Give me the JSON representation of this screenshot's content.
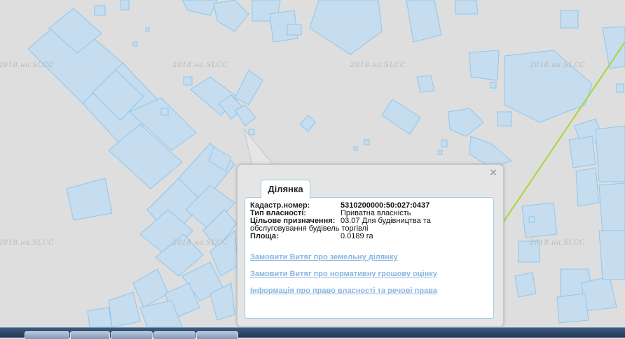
{
  "map": {
    "watermark": "2018.на.SLCC"
  },
  "popup": {
    "close_glyph": "×",
    "tab_label": "Ділянка",
    "fields": {
      "cadastral_label": "Кадастр.номер:",
      "cadastral_value": "5310200000:50:027:0437",
      "ownership_label": "Тип власності:",
      "ownership_value": "Приватна власність",
      "purpose_label": "Цільове призначення:",
      "purpose_value": "03.07 Для будівництва та",
      "purpose_value_cont": "обслуговування будівель торгівлі",
      "area_label": "Площа:",
      "area_value": "0.0189 га"
    },
    "links": {
      "order_extract_land": "Замовити Витяг про земельну ділянку",
      "order_extract_valuation": "Замовити Витяг про нормативну грошову оцінку",
      "ownership_rights_info": "Інформація про право власності та речові права"
    }
  },
  "colors": {
    "parcel_fill": "#c6dcef",
    "parcel_stroke": "#8ec8ee",
    "boundary_line": "#a6d63a",
    "link": "#8ab6e0"
  },
  "icons": [
    "close-icon"
  ]
}
